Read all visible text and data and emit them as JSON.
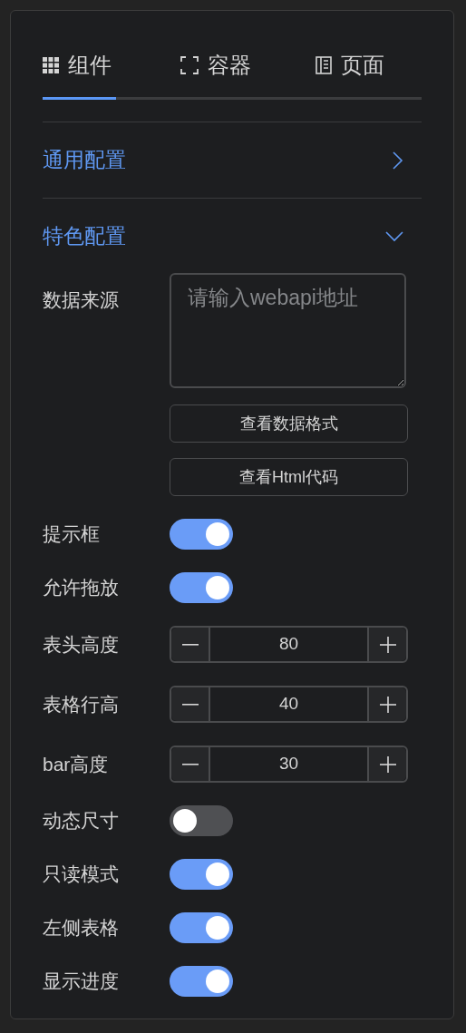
{
  "tabs": [
    {
      "label": "组件",
      "selected": true
    },
    {
      "label": "容器",
      "selected": false
    },
    {
      "label": "页面",
      "selected": false
    }
  ],
  "sections": [
    {
      "title": "通用配置",
      "expanded": false
    },
    {
      "title": "特色配置",
      "expanded": true
    }
  ],
  "fields": [
    {
      "kind": "textarea",
      "label": "数据来源",
      "placeholder": "请输入webapi地址",
      "buttons": [
        "查看数据格式",
        "查看Html代码"
      ]
    },
    {
      "kind": "toggle",
      "label": "提示框",
      "on": true
    },
    {
      "kind": "toggle",
      "label": "允许拖放",
      "on": true
    },
    {
      "kind": "number",
      "label": "表头高度",
      "value": "80"
    },
    {
      "kind": "number",
      "label": "表格行高",
      "value": "40"
    },
    {
      "kind": "number",
      "label": "bar高度",
      "value": "30"
    },
    {
      "kind": "toggle",
      "label": "动态尺寸",
      "on": false
    },
    {
      "kind": "toggle",
      "label": "只读模式",
      "on": true
    },
    {
      "kind": "toggle",
      "label": "左侧表格",
      "on": true
    },
    {
      "kind": "toggle",
      "label": "显示进度",
      "on": true
    }
  ]
}
